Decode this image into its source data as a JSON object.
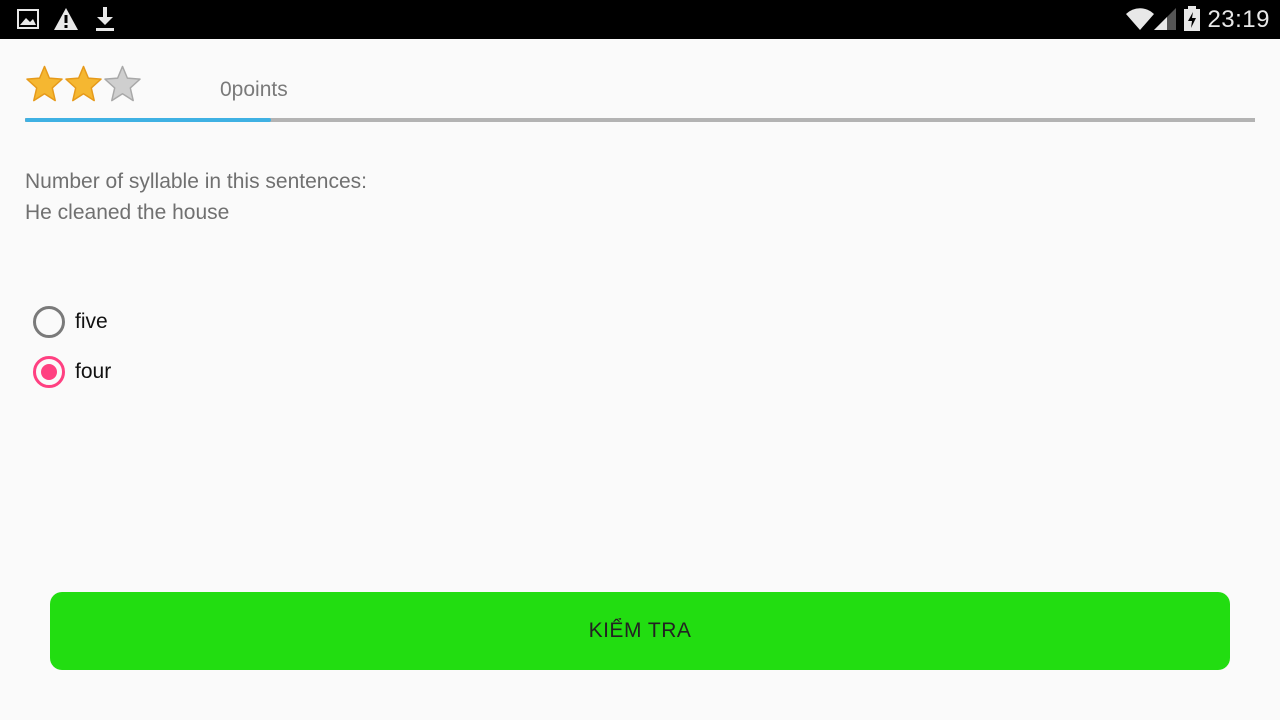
{
  "status_bar": {
    "time": "23:19",
    "left_icons": [
      "image-icon",
      "warning-icon",
      "download-icon"
    ],
    "right_icons": [
      "wifi-icon",
      "signal-icon",
      "battery-charging-icon"
    ]
  },
  "header": {
    "rating": {
      "filled": 2,
      "total": 3
    },
    "points_label": "0points",
    "progress_fraction": 0.2,
    "progress_color": "#3fb1e3"
  },
  "question": {
    "line1": "Number of syllable in this sentences:",
    "line2": "He cleaned the house"
  },
  "options": [
    {
      "label": "five",
      "selected": false
    },
    {
      "label": "four",
      "selected": true
    }
  ],
  "check_button": {
    "label": "KIỂM TRA",
    "color": "#22dd11"
  },
  "colors": {
    "accent_radio": "#ff4081",
    "star_filled": "#f5b731",
    "star_empty": "#cfcfcf"
  }
}
